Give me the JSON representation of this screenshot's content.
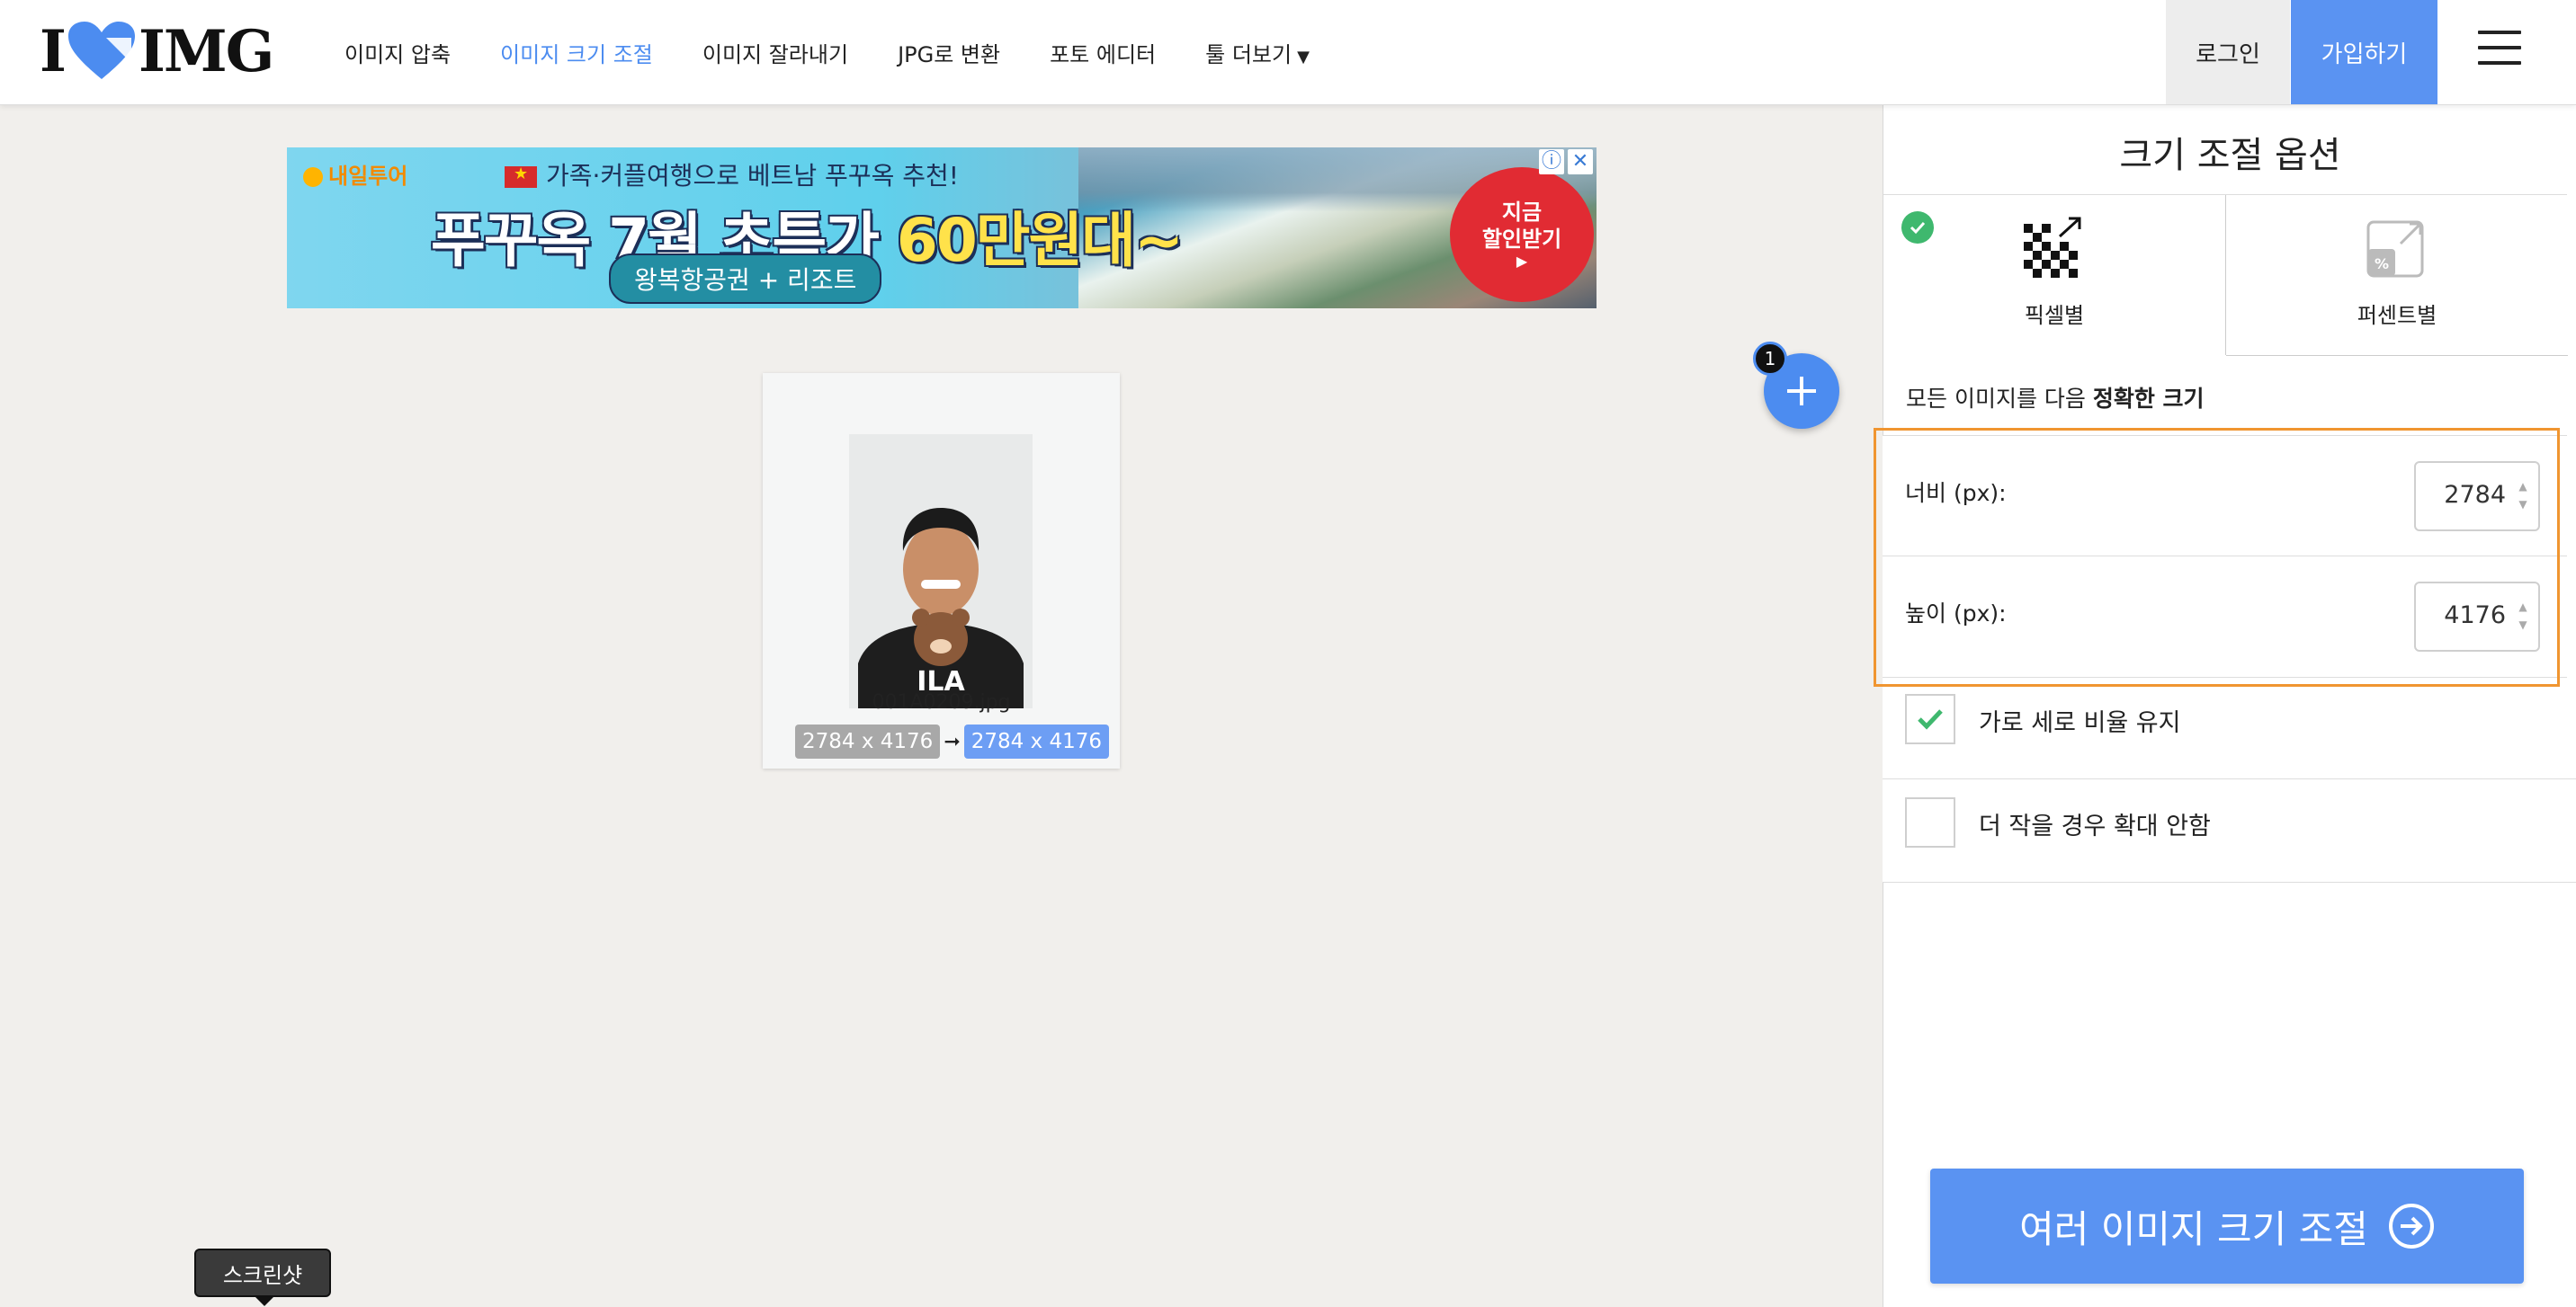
{
  "header": {
    "logo_left": "I",
    "logo_right": "IMG",
    "nav": [
      {
        "label": "이미지 압축",
        "active": false
      },
      {
        "label": "이미지 크기 조절",
        "active": true
      },
      {
        "label": "이미지 잘라내기",
        "active": false
      },
      {
        "label": "JPG로 변환",
        "active": false
      },
      {
        "label": "포토 에디터",
        "active": false
      },
      {
        "label": "툴 더보기",
        "active": false
      }
    ],
    "login": "로그인",
    "signup": "가입하기",
    "accent_color": "#4c8cf0"
  },
  "ad": {
    "brand": "내일투어",
    "subtitle": "가족·커플여행으로 베트남 푸꾸옥 추천!",
    "headline_a": "푸꾸옥 7월 초특가 ",
    "headline_b": "60만원대~",
    "pill": "왕복항공권 + 리조트",
    "cta_line1": "지금",
    "cta_line2": "할인받기",
    "info_icon": "ⓘ",
    "close_icon": "✕"
  },
  "file": {
    "count": "1",
    "name": "001A0209.jpg",
    "original_size": "2784 x 4176",
    "arrow": "➞",
    "new_size": "2784 x 4176"
  },
  "tooltip": "스크린샷",
  "sidebar": {
    "title": "크기 조절 옵션",
    "tabs": [
      {
        "label": "픽셀별",
        "selected": true
      },
      {
        "label": "퍼센트별",
        "selected": false
      }
    ],
    "heading_prefix": "모든 이미지를 다음 ",
    "heading_bold": "정확한 크기",
    "width_label": "너비 (px):",
    "width_value": "2784",
    "height_label": "높이 (px):",
    "height_value": "4176",
    "keep_ratio_label": "가로 세로 비율 유지",
    "keep_ratio_checked": true,
    "no_enlarge_label": "더 작을 경우 확대 안함",
    "no_enlarge_checked": false,
    "submit": "여러 이미지 크기 조절"
  },
  "colors": {
    "primary": "#5a93f2",
    "highlight_border": "#f09530",
    "check_green": "#3fb86e"
  }
}
